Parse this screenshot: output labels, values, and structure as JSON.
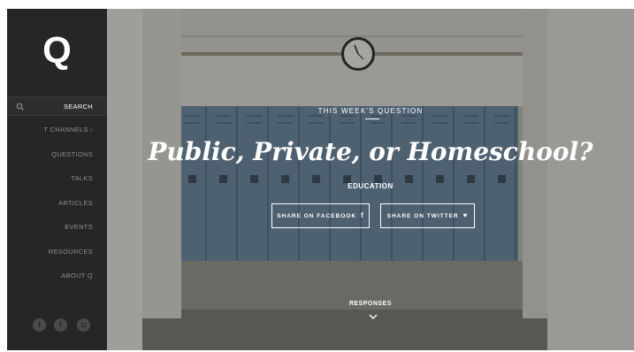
{
  "sidebar": {
    "logo": "Q",
    "search_label": "SEARCH",
    "items": [
      {
        "label": "T CHANNELS",
        "has_chevron": true
      },
      {
        "label": "QUESTIONS"
      },
      {
        "label": "TALKS"
      },
      {
        "label": "ARTICLES"
      },
      {
        "label": "EVENTS"
      },
      {
        "label": "RESOURCES"
      },
      {
        "label": "ABOUT Q"
      }
    ],
    "chevron_glyph": "›",
    "social": [
      {
        "icon": "twitter-icon",
        "glyph": "t"
      },
      {
        "icon": "facebook-icon",
        "glyph": "f"
      },
      {
        "icon": "instagram-icon",
        "glyph": "◘"
      }
    ]
  },
  "hero": {
    "eyebrow": "THIS WEEK'S QUESTION",
    "headline": "Public, Private, or Homeschool?",
    "category": "EDUCATION",
    "share_facebook": "SHARE ON FACEBOOK",
    "share_twitter": "SHARE ON TWITTER",
    "facebook_glyph": "f",
    "twitter_glyph": "♥",
    "responses_label": "RESPONSES",
    "background_image": "school-hallway-lockers"
  },
  "colors": {
    "sidebar_bg": "#262626",
    "sidebar_text": "#8e8e8e",
    "locker_blue": "#6d8aa4",
    "text_white": "#ffffff"
  }
}
